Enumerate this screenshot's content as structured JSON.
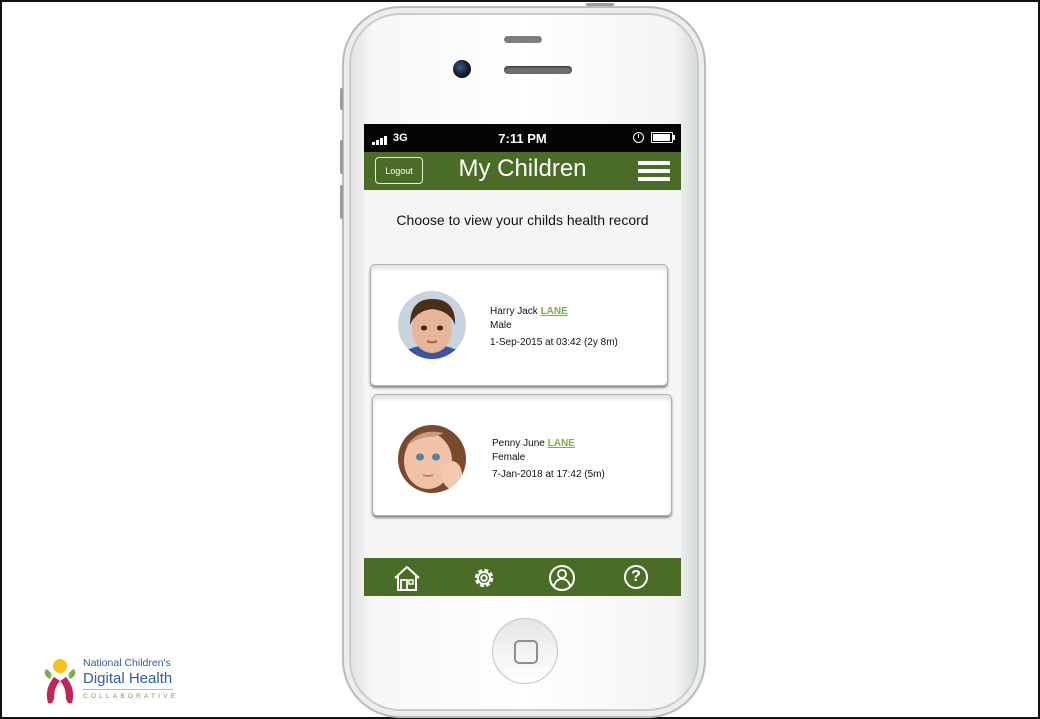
{
  "status_bar": {
    "network": "3G",
    "time": "7:11 PM",
    "battery_level": 0.95
  },
  "header": {
    "logout_label": "Logout",
    "title": "My Children"
  },
  "intro_text": "Choose to view your childs health record",
  "children": [
    {
      "given_names": "Harry Jack",
      "surname": "LANE",
      "sex": "Male",
      "dob": "1-Sep-2015 at 03:42 (2y 8m)"
    },
    {
      "given_names": "Penny June",
      "surname": "LANE",
      "sex": "Female",
      "dob": "7-Jan-2018 at 17:42 (5m)"
    }
  ],
  "nav_items": [
    {
      "icon": "home-icon"
    },
    {
      "icon": "settings-gear-icon"
    },
    {
      "icon": "profile-icon"
    },
    {
      "icon": "help-icon",
      "glyph": "?"
    }
  ],
  "logo": {
    "line1": "National Children's",
    "line2": "Digital Health",
    "line3": "COLLABORATIVE"
  },
  "colors": {
    "brand_green": "#4a6c26",
    "surname_link": "#79b04a",
    "logo_blue": "#2a5fa0"
  }
}
